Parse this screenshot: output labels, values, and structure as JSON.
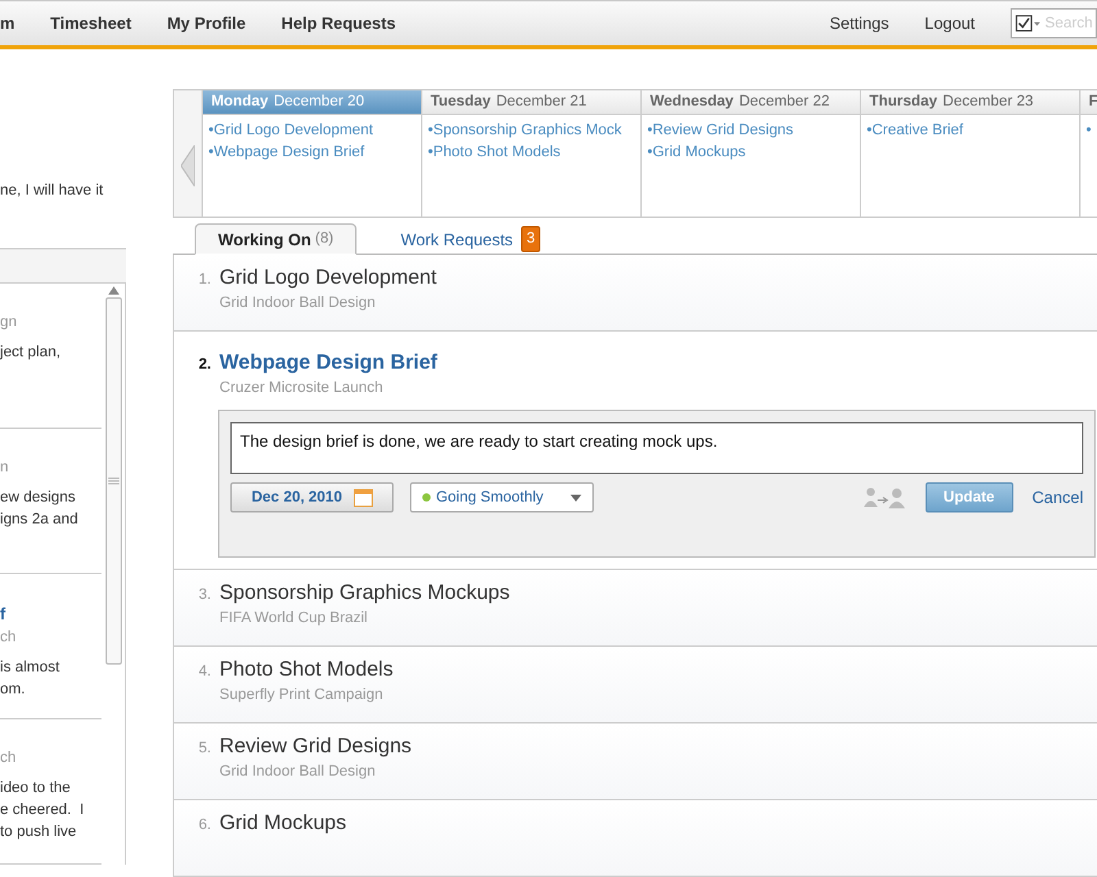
{
  "nav": {
    "left": [
      {
        "label": "m"
      },
      {
        "label": "Timesheet"
      },
      {
        "label": "My Profile"
      },
      {
        "label": "Help Requests"
      }
    ],
    "right": [
      {
        "label": "Settings"
      },
      {
        "label": "Logout"
      }
    ],
    "search": {
      "placeholder": "Search"
    }
  },
  "sidebar": {
    "note": "ne, I will have it",
    "feed": [
      {
        "lines": [
          {
            "text": "gn",
            "kind": "meta"
          },
          {
            "text": "ject plan,",
            "kind": "body"
          }
        ]
      },
      {
        "lines": [
          {
            "text": "n",
            "kind": "meta"
          },
          {
            "text": "ew designs",
            "kind": "body"
          },
          {
            "text": "igns 2a and",
            "kind": "body"
          }
        ]
      },
      {
        "lines": [
          {
            "text": "f",
            "kind": "title"
          },
          {
            "text": "ch",
            "kind": "meta"
          },
          {
            "text": "is almost",
            "kind": "body"
          },
          {
            "text": "om.",
            "kind": "body"
          }
        ]
      },
      {
        "lines": [
          {
            "text": "ch",
            "kind": "meta"
          },
          {
            "text": "ideo to the",
            "kind": "body"
          },
          {
            "text": "e cheered.  I",
            "kind": "body"
          },
          {
            "text": "to push live",
            "kind": "body"
          }
        ]
      }
    ]
  },
  "calendar": {
    "days": [
      {
        "weekday": "Monday",
        "date": "December 20",
        "selected": true,
        "items": [
          "•Grid Logo Development",
          "•Webpage Design Brief"
        ]
      },
      {
        "weekday": "Tuesday",
        "date": "December 21",
        "selected": false,
        "items": [
          "•Sponsorship Graphics Mock",
          "•Photo Shot Models"
        ]
      },
      {
        "weekday": "Wednesday",
        "date": "December 22",
        "selected": false,
        "items": [
          "•Review Grid Designs",
          "•Grid Mockups"
        ]
      },
      {
        "weekday": "Thursday",
        "date": "December 23",
        "selected": false,
        "items": [
          "•Creative Brief"
        ]
      },
      {
        "weekday": "F",
        "selected": false,
        "items": [
          "•"
        ]
      }
    ]
  },
  "tabs": [
    {
      "label": "Working On",
      "count": "(8)",
      "selected": true
    },
    {
      "label": "Work Requests",
      "badge": "3",
      "selected": false
    }
  ],
  "tasks": [
    {
      "number": "1.",
      "title": "Grid Logo Development",
      "project": "Grid Indoor Ball Design",
      "expanded": false
    },
    {
      "number": "2.",
      "title": "Webpage Design Brief",
      "project": "Cruzer Microsite Launch",
      "expanded": true,
      "update": {
        "text": "The design brief is done, we are ready to start creating mock ups.",
        "date": "Dec 20, 2010",
        "status": {
          "label": "Going Smoothly",
          "color": "#8cc63f"
        },
        "submit": "Update",
        "cancel": "Cancel"
      }
    },
    {
      "number": "3.",
      "title": "Sponsorship Graphics Mockups",
      "project": "FIFA World Cup Brazil",
      "expanded": false
    },
    {
      "number": "4.",
      "title": "Photo Shot Models",
      "project": "Superfly Print Campaign",
      "expanded": false
    },
    {
      "number": "5.",
      "title": "Review Grid Designs",
      "project": "Grid Indoor Ball Design",
      "expanded": false
    },
    {
      "number": "6.",
      "title": "Grid Mockups",
      "expanded": false
    }
  ]
}
